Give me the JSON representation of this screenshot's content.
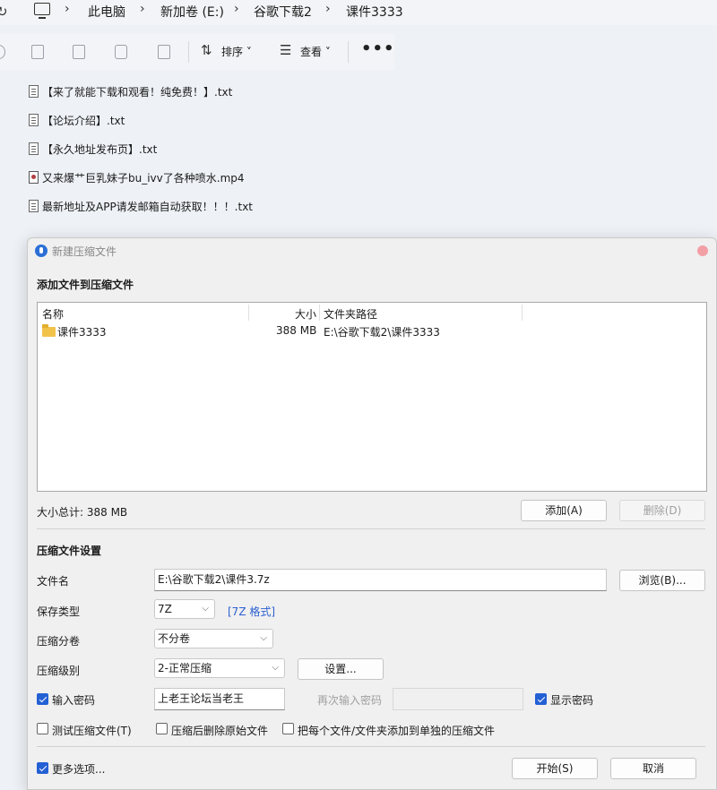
{
  "explorer": {
    "breadcrumb": [
      "此电脑",
      "新加卷 (E:)",
      "谷歌下载2",
      "课件3333"
    ],
    "toolbar": {
      "sort_label": "排序",
      "view_label": "查看",
      "more_label": "•••"
    },
    "files": [
      {
        "name": "【来了就能下载和观看！纯免费！】.txt",
        "type": "txt"
      },
      {
        "name": "【论坛介绍】.txt",
        "type": "txt"
      },
      {
        "name": "【永久地址发布页】.txt",
        "type": "txt"
      },
      {
        "name": "又来爆艹巨乳妹子bu_ivv了各种喷水.mp4",
        "type": "mp4"
      },
      {
        "name": "最新地址及APP请发邮箱自动获取！！！.txt",
        "type": "txt"
      }
    ]
  },
  "dialog": {
    "title": "新建压缩文件",
    "add_section_title": "添加文件到压缩文件",
    "columns": {
      "name": "名称",
      "size": "大小",
      "path": "文件夹路径"
    },
    "rows": [
      {
        "name": "课件3333",
        "size": "388 MB",
        "path": "E:\\谷歌下载2\\课件3333"
      }
    ],
    "total_size": "大小总计: 388 MB",
    "add_button": "添加(A)",
    "delete_button": "删除(D)",
    "settings_title": "压缩文件设置",
    "filename_label": "文件名",
    "filename_value": "E:\\谷歌下载2\\课件3.7z",
    "browse_button": "浏览(B)...",
    "type_label": "保存类型",
    "type_value": "7Z",
    "type_format_link": "[7Z 格式]",
    "volume_label": "压缩分卷",
    "volume_value": "不分卷",
    "level_label": "压缩级别",
    "level_value": "2-正常压缩",
    "settings_button": "设置...",
    "password_label": "输入密码",
    "password_value": "上老王论坛当老王",
    "reenter_label": "再次输入密码",
    "show_password_label": "显示密码",
    "test_label": "测试压缩文件(T)",
    "delete_after_label": "压缩后删除原始文件",
    "separate_label": "把每个文件/文件夹添加到单独的压缩文件",
    "more_options_label": "更多选项...",
    "start_button": "开始(S)",
    "cancel_button": "取消"
  },
  "icons": {
    "refresh": "refresh-icon",
    "pc": "computer-icon",
    "copy": "copy-icon",
    "rename": "rename-icon",
    "share": "share-icon",
    "delete": "trash-icon",
    "sort": "sort-icon",
    "view": "view-icon",
    "txt": "text-file-icon",
    "mp4": "video-file-icon",
    "folder": "folder-icon",
    "app": "app-logo-icon"
  },
  "colors": {
    "accent": "#2360d4",
    "link": "#2b5fd1",
    "folder": "#f2c34b",
    "close": "#f2a0a6"
  }
}
